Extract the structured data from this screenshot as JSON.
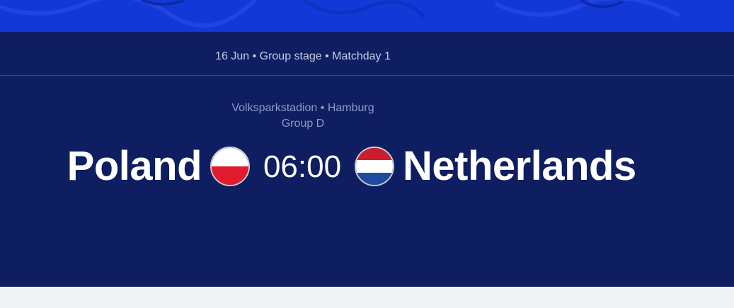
{
  "colors": {
    "top_banner": "#1238d8",
    "panel_background": "#0e1e61",
    "page_background": "#f1f2f4",
    "meta_text": "#c5cbe4",
    "venue_text": "#8f9ac4",
    "team_text": "#ffffff"
  },
  "match": {
    "meta": "16 Jun • Group stage • Matchday 1",
    "venue": "Volksparkstadion • Hamburg",
    "group": "Group D",
    "kickoff_time": "06:00",
    "home_team": {
      "name": "Poland",
      "flag_icon": "poland-flag-icon",
      "flag_colors": [
        "#ffffff",
        "#e01c2c"
      ]
    },
    "away_team": {
      "name": "Netherlands",
      "flag_icon": "netherlands-flag-icon",
      "flag_colors": [
        "#ce1c2f",
        "#ffffff",
        "#1f4b9e"
      ]
    }
  }
}
